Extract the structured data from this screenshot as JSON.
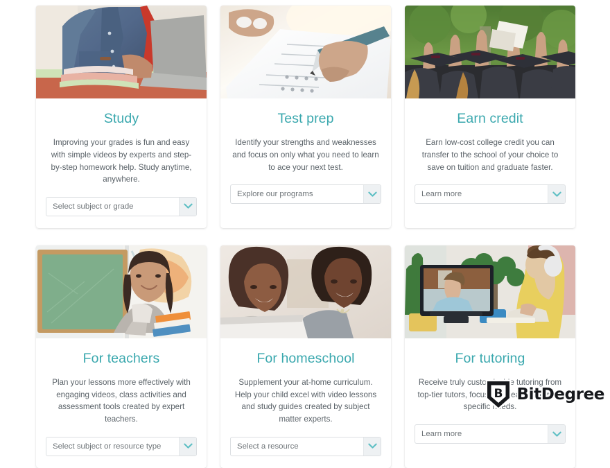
{
  "page": {
    "background": "#ffffff",
    "accent_color": "#3aa8ae",
    "body_text_color": "#5a6268"
  },
  "cards": [
    {
      "id": "study",
      "title": "Study",
      "description": "Improving your grades is fun and easy with simple videos by experts and step-by-step homework help. Study anytime, anywhere.",
      "select_value": "Select subject or grade",
      "image_alt": "Student in denim jacket and red shirt typing on a laptop with notebooks on the desk"
    },
    {
      "id": "test-prep",
      "title": "Test prep",
      "description": "Identify your strengths and weaknesses and focus on only what you need to learn to ace your next test.",
      "select_value": "Explore our programs",
      "image_alt": "Hand holding a pen filling in a multiple choice answer sheet"
    },
    {
      "id": "earn-credit",
      "title": "Earn credit",
      "description": "Earn low-cost college credit you can transfer to the school of your choice to save on tuition and graduate faster.",
      "select_value": "Learn more",
      "image_alt": "Graduates in caps and gowns raising their hands and diplomas at a ceremony"
    },
    {
      "id": "for-teachers",
      "title": "For teachers",
      "description": "Plan your lessons more effectively with engaging videos, class activities and assessment tools created by expert teachers.",
      "select_value": "Select subject or resource type",
      "image_alt": "Smiling teacher standing beside a green chalkboard holding books"
    },
    {
      "id": "for-homeschool",
      "title": "For homeschool",
      "description": "Supplement your at-home curriculum. Help your child excel with video lessons and study guides created by subject matter experts.",
      "select_value": "Select a resource",
      "image_alt": "Mother and daughter smiling while looking at a laptop together"
    },
    {
      "id": "for-tutoring",
      "title": "For tutoring",
      "description": "Receive truly customizable tutoring from top-tier tutors, focused on each student's specific needs.",
      "select_value": "Learn more",
      "image_alt": "Woman with headphones taking an online tutoring session at a desk with a monitor"
    }
  ],
  "icons": {
    "dropdown_chevron": "chevron-down-icon",
    "watermark_shield": "bitdegree-shield-icon"
  },
  "watermark": {
    "text": "BitDegree",
    "shield_letter": "B"
  }
}
